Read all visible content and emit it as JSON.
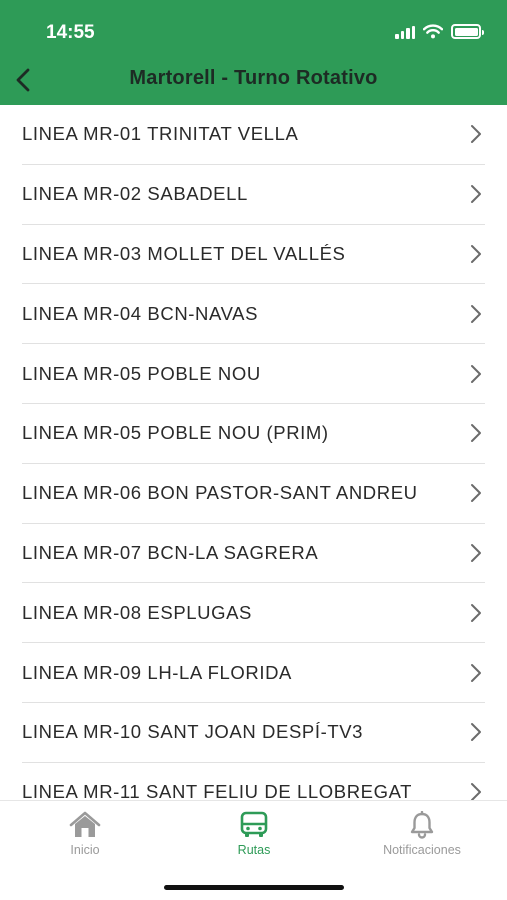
{
  "status_bar": {
    "time": "14:55"
  },
  "header": {
    "title": "Martorell - Turno Rotativo"
  },
  "routes": [
    {
      "label": "LINEA MR-01 TRINITAT VELLA"
    },
    {
      "label": "LINEA MR-02 SABADELL"
    },
    {
      "label": "LINEA MR-03 MOLLET DEL VALLÉS"
    },
    {
      "label": "LINEA MR-04 BCN-NAVAS"
    },
    {
      "label": "LINEA MR-05 POBLE NOU"
    },
    {
      "label": "LINEA MR-05 POBLE NOU (PRIM)"
    },
    {
      "label": "LINEA MR-06 BON PASTOR-SANT ANDREU"
    },
    {
      "label": "LINEA MR-07 BCN-LA SAGRERA"
    },
    {
      "label": "LINEA MR-08 ESPLUGAS"
    },
    {
      "label": "LINEA MR-09 LH-LA FLORIDA"
    },
    {
      "label": "LINEA MR-10 SANT JOAN DESPÍ-TV3"
    },
    {
      "label": "LINEA MR-11 SANT FELIU DE LLOBREGAT"
    }
  ],
  "tabbar": {
    "tabs": [
      {
        "label": "Inicio",
        "icon": "home-icon",
        "active": false
      },
      {
        "label": "Rutas",
        "icon": "bus-icon",
        "active": true
      },
      {
        "label": "Notificaciones",
        "icon": "bell-icon",
        "active": false
      }
    ]
  },
  "colors": {
    "brand_green": "#2e9b57",
    "inactive_gray": "#9a9a9a"
  }
}
